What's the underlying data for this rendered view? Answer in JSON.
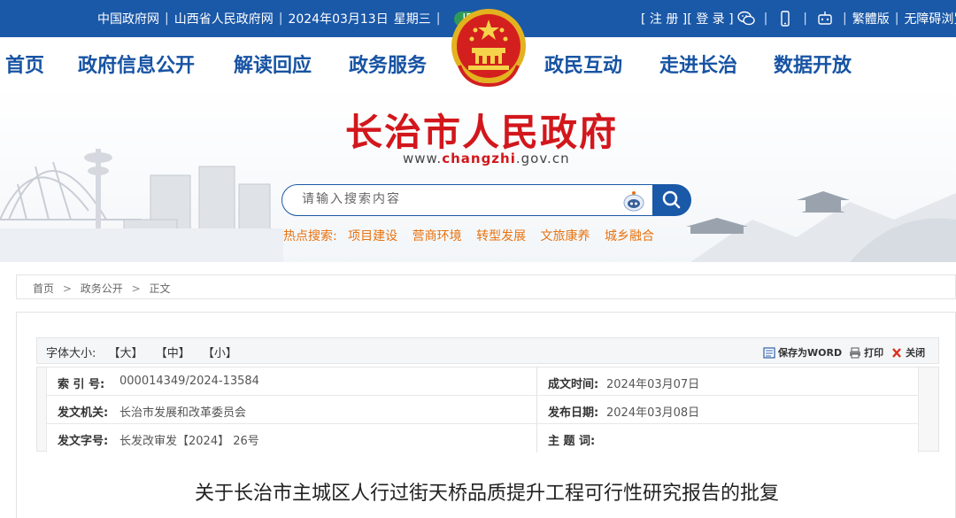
{
  "topbar": {
    "links": [
      "中国政府网",
      "山西省人民政府网"
    ],
    "date": "2024年03月13日",
    "weekday": "星期三",
    "ipv6": "IPV6",
    "register": "[ 注 册 ]",
    "login": "[ 登 录 ]",
    "traditional": "繁體版",
    "accessible": "无障碍浏览"
  },
  "nav": {
    "items": [
      "首页",
      "政府信息公开",
      "解读回应",
      "政务服务",
      "政民互动",
      "走进长治",
      "数据开放"
    ]
  },
  "banner": {
    "title": "长治市人民政府",
    "url_prefix": "www.",
    "url_highlight": "changzhi",
    "url_suffix": ".gov.cn",
    "search_placeholder": "请输入搜索内容",
    "hot_label": "热点搜索:",
    "hot_items": [
      "项目建设",
      "营商环境",
      "转型发展",
      "文旅康养",
      "城乡融合"
    ]
  },
  "breadcrumb": [
    "首页",
    "政务公开",
    "正文"
  ],
  "toolbar": {
    "font_size_label": "字体大小:",
    "font_sizes": [
      "【大】",
      "【中】",
      "【小】"
    ],
    "save_word": "保存为WORD",
    "print": "打印",
    "close": "关闭"
  },
  "meta": {
    "index_label": "索 引 号:",
    "index_value": "000014349/2024-13584",
    "date_label": "成文时间:",
    "date_value": "2024年03月07日",
    "issuer_label": "发文机关:",
    "issuer_value": "长治市发展和改革委员会",
    "publish_label": "发布日期:",
    "publish_value": "2024年03月08日",
    "docno_label": "发文字号:",
    "docno_value": "长发改审发【2024】 26号",
    "subject_label": "主 题 词:",
    "subject_value": ""
  },
  "document": {
    "title": "关于长治市主城区人行过街天桥品质提升工程可行性研究报告的批复"
  },
  "colors": {
    "brand_blue": "#1a58a8",
    "title_red": "#d2171c",
    "hot_orange": "#e8720f",
    "ipv6_green": "#2f9a58"
  }
}
